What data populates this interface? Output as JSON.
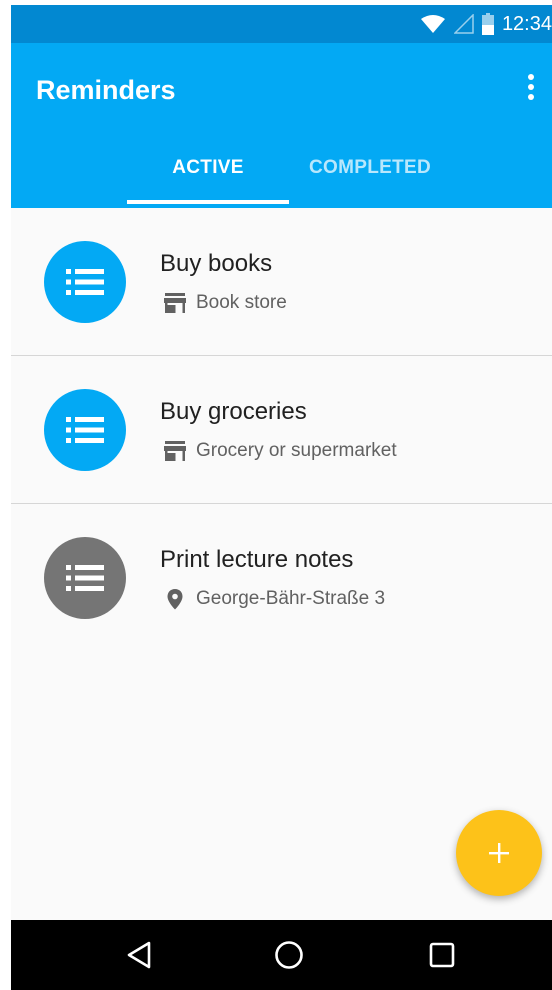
{
  "status_bar": {
    "time": "12:34",
    "icons": [
      "wifi-icon",
      "signal-icon",
      "battery-icon"
    ]
  },
  "app_bar": {
    "title": "Reminders",
    "menu_icon": "overflow-menu-icon",
    "tabs": [
      {
        "label": "ACTIVE",
        "selected": true
      },
      {
        "label": "COMPLETED",
        "selected": false
      }
    ]
  },
  "reminders": [
    {
      "title": "Buy books",
      "subtitle": "Book store",
      "icon": "list-icon",
      "sub_icon": "store-icon",
      "color": "#03a9f4"
    },
    {
      "title": "Buy groceries",
      "subtitle": "Grocery or supermarket",
      "icon": "list-icon",
      "sub_icon": "store-icon",
      "color": "#03a9f4"
    },
    {
      "title": "Print lecture notes",
      "subtitle": "George-Bähr-Straße 3",
      "icon": "list-icon",
      "sub_icon": "location-pin-icon",
      "color": "#757575"
    }
  ],
  "fab": {
    "icon": "add-icon",
    "color": "#fdc219"
  },
  "nav_bar": {
    "icons": [
      "back-icon",
      "home-icon",
      "recents-icon"
    ]
  },
  "colors": {
    "primary": "#03a9f4",
    "primary_dark": "#0288d1",
    "accent": "#fdc219"
  }
}
